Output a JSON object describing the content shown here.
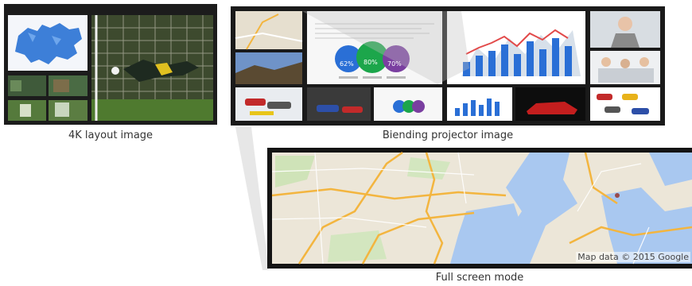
{
  "captions": {
    "layout_4k": "4K layout image",
    "blending": "Biending projector image",
    "fullscreen": "Full screen mode"
  },
  "slide": {
    "percent_1": "62%",
    "percent_2": "80%",
    "percent_3": "70%"
  },
  "map": {
    "attribution": "Map data © 2015 Google"
  },
  "colors": {
    "frame": "#1a1a1a",
    "blue": "#2a6fd6",
    "green": "#1ca64b",
    "purple": "#7a3fa0",
    "water": "#a9c8f0",
    "land": "#ece6d8",
    "road": "#f3b53f"
  }
}
